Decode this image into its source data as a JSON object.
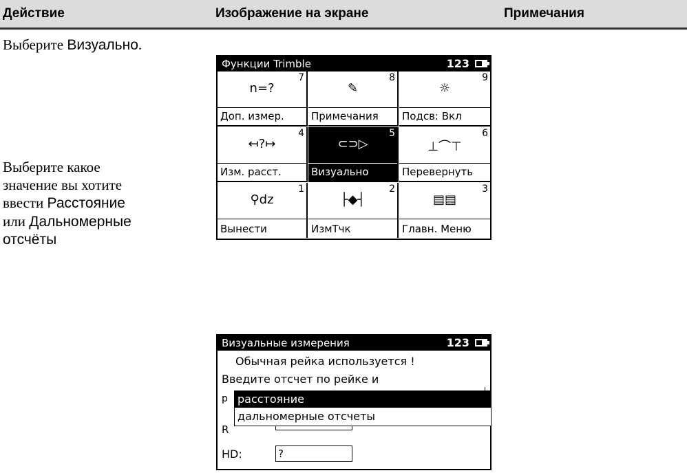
{
  "table_header": {
    "col1": "Действие",
    "col2": "Изображение на экране",
    "col3": "Примечания"
  },
  "step1": {
    "text_prefix": "Выберите ",
    "text_ui": "Визуально",
    "text_suffix": "."
  },
  "step2": {
    "line1": "Выберите какое",
    "line2": "значение вы хотите",
    "line3_prefix": "ввести ",
    "line3_ui": "Расстояние",
    "line4_prefix": "или ",
    "line4_ui": "Дальномерные",
    "line5_ui": "отсчёты"
  },
  "screen1": {
    "title": "Функции Trimble",
    "indicator": "123",
    "cells": [
      {
        "num": "7",
        "icon": "n=?",
        "icon_name": "n-question-icon",
        "label": "Доп. измер."
      },
      {
        "num": "8",
        "icon": "✎",
        "icon_name": "notes-icon",
        "label": "Примечания"
      },
      {
        "num": "9",
        "icon": "☼",
        "icon_name": "backlight-icon",
        "label": "Подсв: Вкл"
      },
      {
        "num": "4",
        "icon": "↤?↦",
        "icon_name": "measure-distance-icon",
        "label": "Изм. расст."
      },
      {
        "num": "5",
        "icon": "⊂⊃▷",
        "icon_name": "visual-icon",
        "label": "Визуально",
        "selected": true
      },
      {
        "num": "6",
        "icon": "⊥⌒⊤",
        "icon_name": "flip-icon",
        "label": "Перевернуть"
      },
      {
        "num": "1",
        "icon": "⚲dz",
        "icon_name": "stakeout-icon",
        "label": "Вынести"
      },
      {
        "num": "2",
        "icon": "├◆┤",
        "icon_name": "measure-point-icon",
        "label": "ИзмТчк"
      },
      {
        "num": "3",
        "icon": "▤▤",
        "icon_name": "main-menu-icon",
        "label": "Главн. Меню"
      }
    ]
  },
  "screen2": {
    "title": "Визуальные измерения",
    "indicator": "123",
    "line1": "Обычная рейка используется !",
    "line2": "Введите отсчет по рейке и",
    "hidden_under1": "р",
    "hidden_under2": "R",
    "hd_label": "HD:",
    "hd_value": "?",
    "dropdown_options": [
      "расстояние",
      "дальномерные отсчеты"
    ]
  }
}
